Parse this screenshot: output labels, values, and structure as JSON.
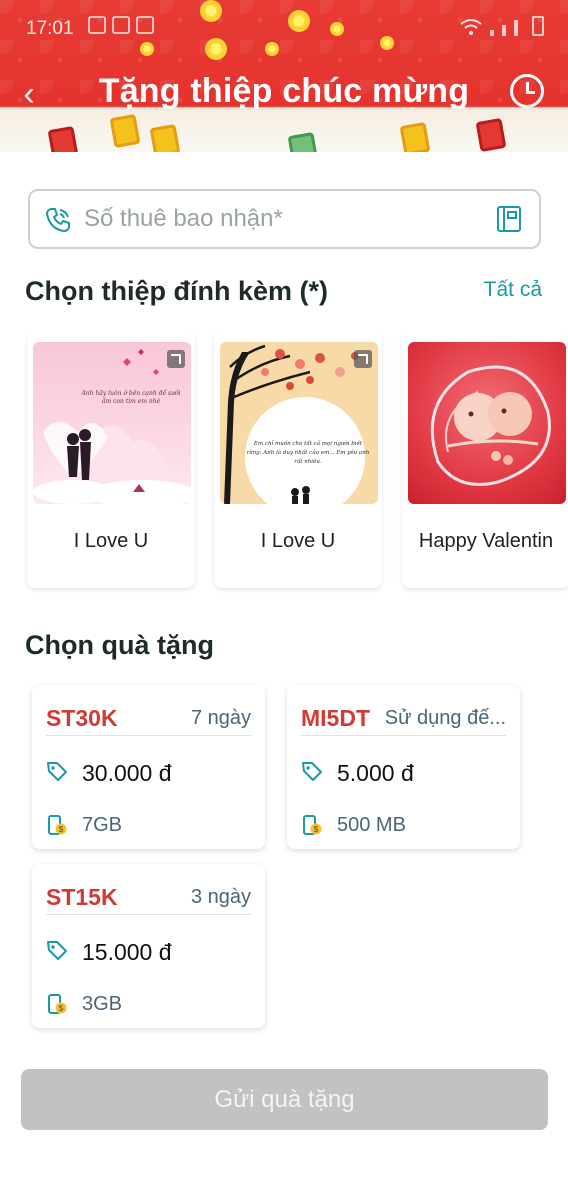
{
  "status_bar": {
    "time": "17:01"
  },
  "header": {
    "back_glyph": "‹",
    "title": "Tặng thiệp chúc mừng"
  },
  "phone_input": {
    "placeholder": "Số thuê bao nhận*",
    "value": ""
  },
  "cards_section": {
    "title": "Chọn thiệp đính kèm (*)",
    "see_all": "Tất cả",
    "cards": [
      {
        "label": "I Love U",
        "image_text": "Anh hãy luôn ở bên cạnh để sưởi ấm con tim em nhé"
      },
      {
        "label": "I Love U",
        "image_text": "Em chỉ muốn cho tất cả mọi người biết rằng: Anh là duy nhất của em... Em yêu anh rất nhiều."
      },
      {
        "label": "Happy Valentin"
      }
    ]
  },
  "gifts_section": {
    "title": "Chọn quà tặng",
    "gifts": [
      {
        "code": "ST30K",
        "duration": "7 ngày",
        "price": "30.000 đ",
        "data": "7GB"
      },
      {
        "code": "MI5DT",
        "duration": "Sử dụng đế...",
        "price": "5.000 đ",
        "data": "500 MB"
      },
      {
        "code": "ST15K",
        "duration": "3 ngày",
        "price": "15.000 đ",
        "data": "3GB"
      }
    ]
  },
  "submit": {
    "label": "Gửi quà tặng"
  },
  "colors": {
    "header_red": "#e5332e",
    "accent_teal": "#1a9aa5",
    "code_red": "#d23a34",
    "button_disabled": "#c2c2c2"
  },
  "icons": [
    "back-arrow-icon",
    "clock-history-icon",
    "phone-call-icon",
    "contact-book-icon",
    "expand-icon",
    "price-tag-icon",
    "mobile-data-icon"
  ]
}
